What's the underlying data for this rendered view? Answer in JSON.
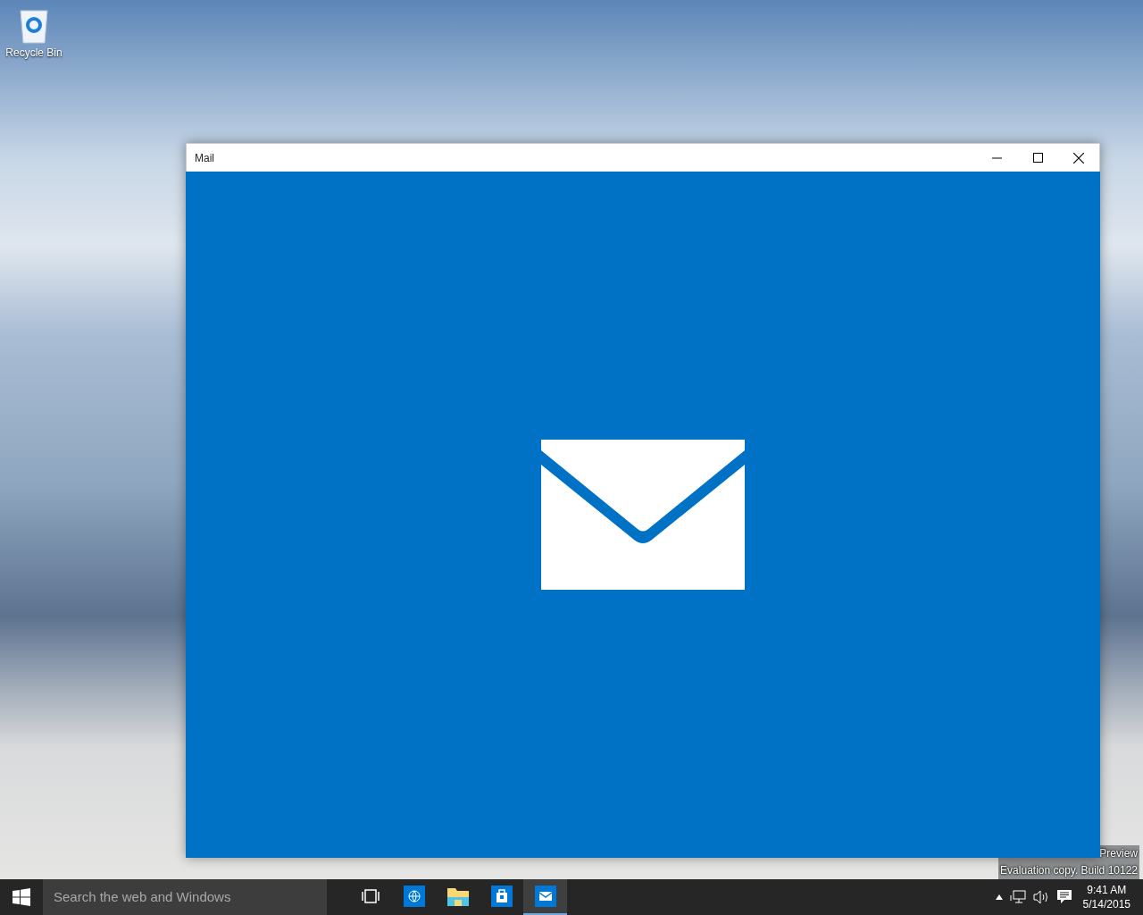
{
  "desktop": {
    "icons": [
      {
        "label": "Recycle Bin"
      }
    ],
    "notice_lines": [
      "Preview",
      "Evaluation copy. Build 10122"
    ]
  },
  "window": {
    "title": "Mail"
  },
  "taskbar": {
    "search": {
      "placeholder": "Search the web and Windows"
    },
    "apps": [
      {
        "kind": "task-view",
        "selected": false
      },
      {
        "kind": "browser",
        "selected": false
      },
      {
        "kind": "folder",
        "selected": false
      },
      {
        "kind": "store",
        "selected": false
      },
      {
        "kind": "mail",
        "selected": true
      }
    ],
    "clock": {
      "time": "9:41 AM",
      "date": "5/14/2015"
    }
  }
}
